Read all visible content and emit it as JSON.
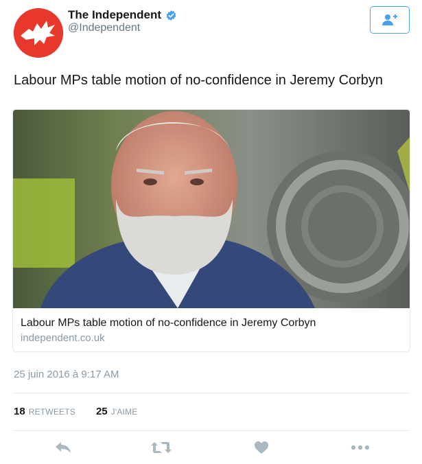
{
  "author": {
    "display_name": "The Independent",
    "handle": "@Independent",
    "verified": true,
    "avatar_color": "#e8372b"
  },
  "follow_button": {
    "icon": "add-user-icon",
    "color": "#4aa1eb"
  },
  "tweet": {
    "text": "Labour MPs table motion of no-confidence in Jeremy Corbyn"
  },
  "card": {
    "title": "Labour MPs table motion of no-confidence in Jeremy Corbyn",
    "domain": "independent.co.uk",
    "image": "photo-of-jeremy-corbyn"
  },
  "timestamp": "25 juin 2016 à 9:17 AM",
  "stats": {
    "retweets_count": "18",
    "retweets_label": "RETWEETS",
    "likes_count": "25",
    "likes_label": "J'AIME"
  },
  "actions": [
    "reply-icon",
    "retweet-icon",
    "like-heart-icon",
    "more-options-icon"
  ],
  "colors": {
    "accent": "#4aa1eb",
    "muted": "#8899a6",
    "icon": "#aab8c2"
  }
}
